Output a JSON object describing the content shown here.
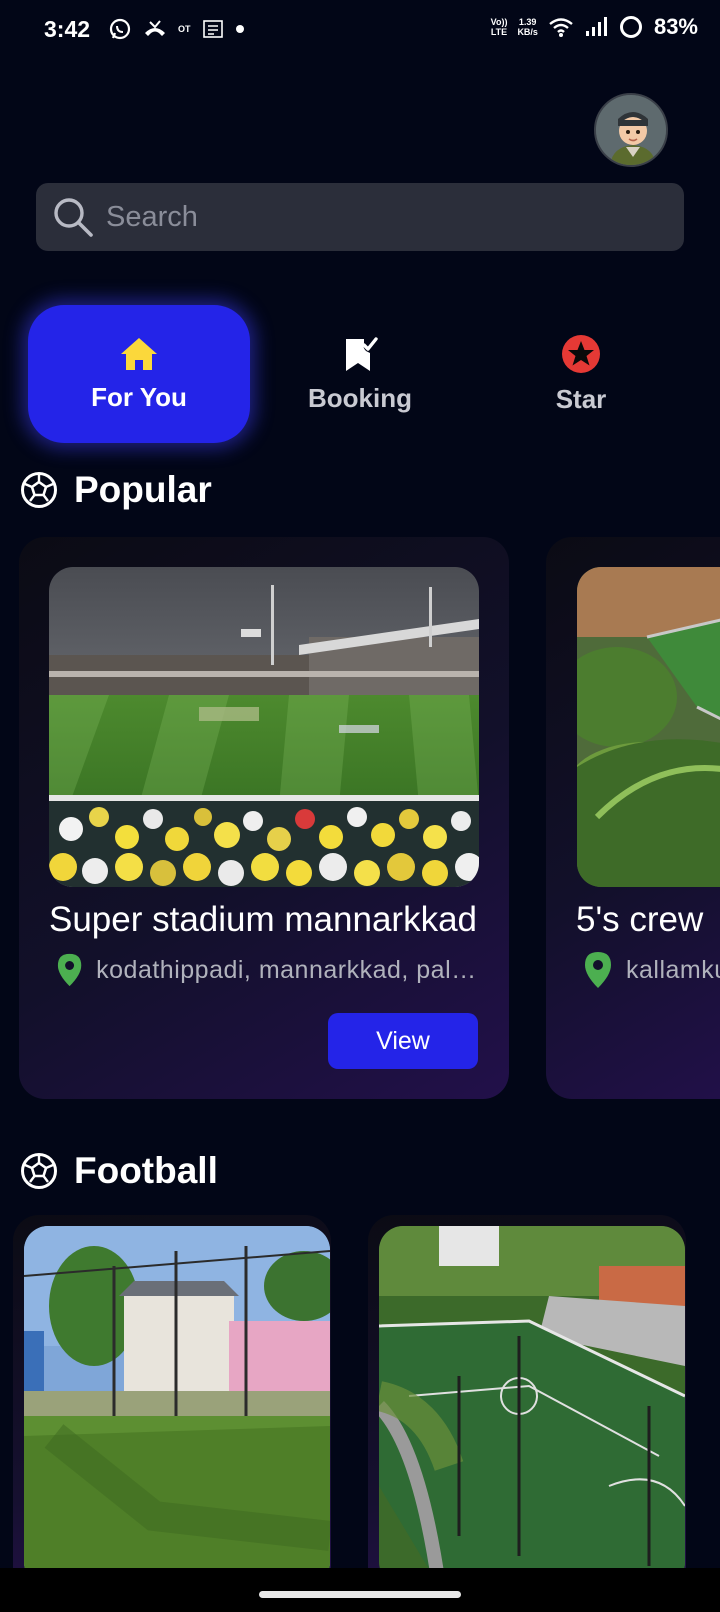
{
  "status_bar": {
    "time": "3:42",
    "volte_top": "Vo))",
    "volte_bottom": "LTE",
    "speed_top": "1.39",
    "speed_bottom": "KB/s",
    "ot_label": "OT",
    "battery": "83%"
  },
  "search": {
    "placeholder": "Search"
  },
  "tabs": [
    {
      "label": "For You",
      "icon": "home-icon",
      "active": true
    },
    {
      "label": "Booking",
      "icon": "bookmark-check-icon",
      "active": false
    },
    {
      "label": "Star",
      "icon": "star-icon",
      "active": false
    }
  ],
  "sections": {
    "popular": {
      "title": "Popular"
    },
    "football": {
      "title": "Football"
    }
  },
  "popular_cards": [
    {
      "title": "Super stadium mannarkkad",
      "location": "kodathippadi, mannarkkad, palakkad",
      "button": "View"
    },
    {
      "title": "5's crew",
      "location": "kallamkuzhi"
    }
  ],
  "colors": {
    "background": "#020617",
    "accent": "#2424e8",
    "home_icon": "#fbd83b",
    "star_badge": "#e53935",
    "location_pin": "#4caf50"
  }
}
